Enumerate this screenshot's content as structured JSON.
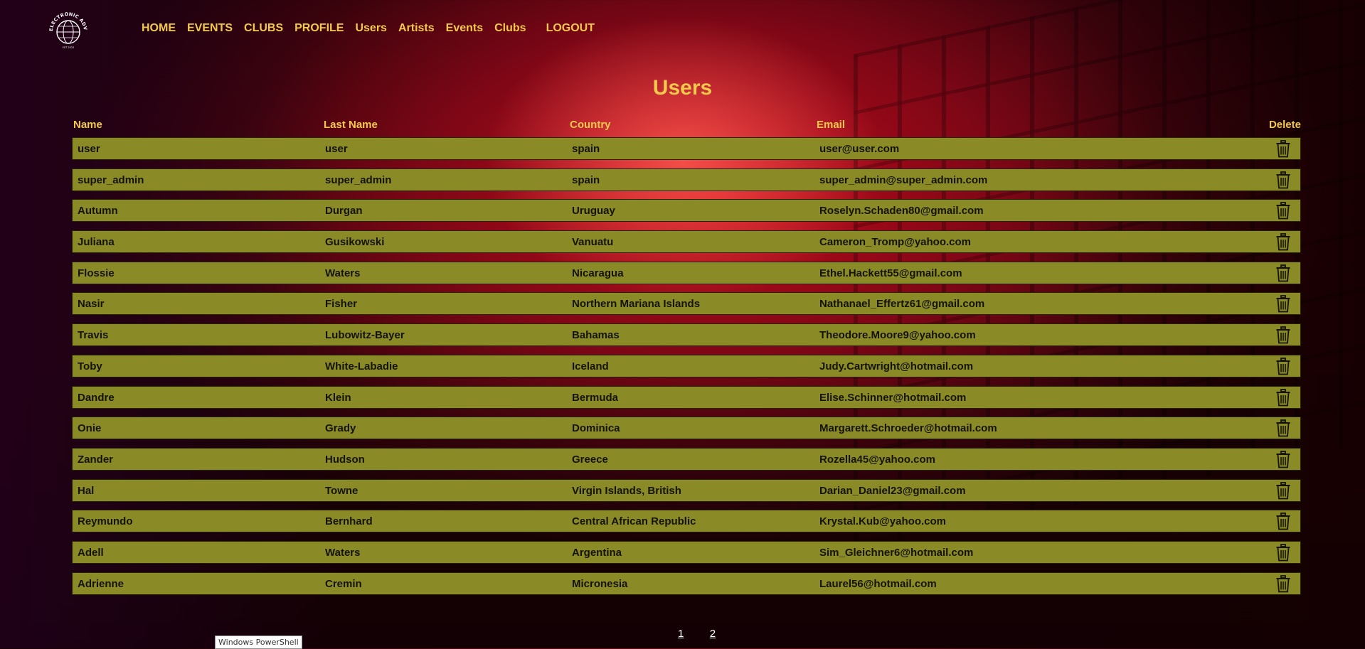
{
  "logo": {
    "text": "ELECTRONIC ADVISOR",
    "tagline": "EST 2022"
  },
  "nav": [
    "HOME",
    "EVENTS",
    "CLUBS",
    "PROFILE",
    "Users",
    "Artists",
    "Events",
    "Clubs"
  ],
  "logout": "LOGOUT",
  "page_title": "Users",
  "columns": {
    "name": "Name",
    "last_name": "Last Name",
    "country": "Country",
    "email": "Email",
    "delete": "Delete"
  },
  "rows": [
    [
      "user",
      "user",
      "spain",
      "user@user.com"
    ],
    [
      "super_admin",
      "super_admin",
      "spain",
      "super_admin@super_admin.com"
    ],
    [
      "Autumn",
      "Durgan",
      "Uruguay",
      "Roselyn.Schaden80@gmail.com"
    ],
    [
      "Juliana",
      "Gusikowski",
      "Vanuatu",
      "Cameron_Tromp@yahoo.com"
    ],
    [
      "Flossie",
      "Waters",
      "Nicaragua",
      "Ethel.Hackett55@gmail.com"
    ],
    [
      "Nasir",
      "Fisher",
      "Northern Mariana Islands",
      "Nathanael_Effertz61@gmail.com"
    ],
    [
      "Travis",
      "Lubowitz-Bayer",
      "Bahamas",
      "Theodore.Moore9@yahoo.com"
    ],
    [
      "Toby",
      "White-Labadie",
      "Iceland",
      "Judy.Cartwright@hotmail.com"
    ],
    [
      "Dandre",
      "Klein",
      "Bermuda",
      "Elise.Schinner@hotmail.com"
    ],
    [
      "Onie",
      "Grady",
      "Dominica",
      "Margarett.Schroeder@hotmail.com"
    ],
    [
      "Zander",
      "Hudson",
      "Greece",
      "Rozella45@yahoo.com"
    ],
    [
      "Hal",
      "Towne",
      "Virgin Islands, British",
      "Darian_Daniel23@gmail.com"
    ],
    [
      "Reymundo",
      "Bernhard",
      "Central African Republic",
      "Krystal.Kub@yahoo.com"
    ],
    [
      "Adell",
      "Waters",
      "Argentina",
      "Sim_Gleichner6@hotmail.com"
    ],
    [
      "Adrienne",
      "Cremin",
      "Micronesia",
      "Laurel56@hotmail.com"
    ]
  ],
  "pagination": [
    "1",
    "2"
  ],
  "tooltip": "Windows PowerShell",
  "colors": {
    "accent": "#f2c94c",
    "row_bg": "#8a8a26",
    "background": "#9c0a1a"
  },
  "icons": {
    "delete": "trash-icon"
  }
}
